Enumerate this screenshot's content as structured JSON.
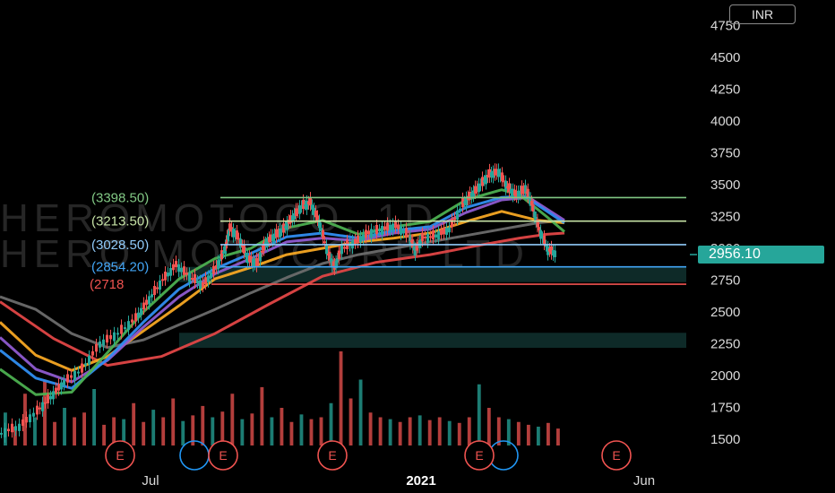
{
  "header": {
    "currency": "INR"
  },
  "watermark": {
    "symbol": "HEROMOTOCO, 1D",
    "name": "HERO MOTOCORP LTD"
  },
  "price_tag": {
    "value": "2956.10",
    "color": "#26a69a"
  },
  "colors": {
    "up": "#26a69a",
    "down": "#ef5350",
    "ma_green": "#4caf50",
    "ma_teal": "#26c6a0",
    "ma_blue": "#2f8df0",
    "ma_purple": "#8e5bd0",
    "ma_orange": "#f5a623",
    "ma_red": "#e04646",
    "ma_gray": "#6b6b6b",
    "event_marker": "#ef5350",
    "split_marker": "#2196f3"
  },
  "event_markers": {
    "earnings_label": "E"
  },
  "chart_data": {
    "type": "line",
    "title": "",
    "ylim": [
      1400,
      4800
    ],
    "y_ticks": [
      "4750",
      "4500",
      "4250",
      "4000",
      "3750",
      "3500",
      "3250",
      "3000",
      "2750",
      "2500",
      "2250",
      "2000",
      "1750",
      "1500"
    ],
    "x_tick_labels": [
      "Jul",
      "2021",
      "Jun"
    ],
    "levels": [
      {
        "label": "(3398.50)",
        "value": 3398.5,
        "color": "#81c784"
      },
      {
        "label": "(3213.50)",
        "value": 3213.5,
        "color": "#c5e1a5"
      },
      {
        "label": "(3028.50)",
        "value": 3028.5,
        "color": "#90caf9"
      },
      {
        "label": "(2854.20)",
        "value": 2854.2,
        "color": "#42a5f5"
      },
      {
        "label": "(2718",
        "value": 2718,
        "color": "#ef5350"
      }
    ],
    "zones": [
      {
        "from": 2734,
        "to": 2854,
        "color": "#0e2a28"
      },
      {
        "from": 2218,
        "to": 2336,
        "color": "#0e2a28"
      }
    ],
    "price_series": {
      "name": "",
      "x": [
        0,
        20,
        40,
        55,
        70,
        90,
        110,
        130,
        150,
        165,
        180,
        195,
        210,
        225,
        240,
        250,
        255,
        265,
        275,
        285,
        295,
        305,
        315,
        325,
        335,
        345,
        355,
        365,
        372,
        380,
        395,
        410,
        425,
        440,
        455,
        462,
        470,
        485,
        500,
        515,
        525,
        535,
        545,
        555,
        565,
        575,
        585,
        592,
        600,
        610,
        620
      ],
      "values": [
        1550,
        1600,
        1720,
        1830,
        1950,
        2050,
        2250,
        2330,
        2450,
        2600,
        2750,
        2870,
        2780,
        2710,
        2850,
        3000,
        3160,
        3080,
        2920,
        2880,
        3040,
        3100,
        3150,
        3240,
        3330,
        3360,
        3200,
        2950,
        2850,
        3000,
        3050,
        3120,
        3150,
        3180,
        3100,
        2980,
        3080,
        3100,
        3150,
        3350,
        3420,
        3500,
        3580,
        3600,
        3480,
        3420,
        3470,
        3350,
        3150,
        2990,
        2956
      ]
    },
    "moving_averages": [
      {
        "name": "",
        "color": "#6b6b6b",
        "x": [
          0,
          40,
          80,
          120,
          160,
          200,
          240,
          280,
          320,
          360,
          400,
          440,
          480,
          520,
          560,
          600,
          630
        ],
        "values": [
          2620,
          2520,
          2330,
          2220,
          2280,
          2400,
          2520,
          2650,
          2770,
          2880,
          2950,
          3000,
          3050,
          3100,
          3150,
          3200,
          3220
        ]
      },
      {
        "name": "",
        "color": "#e04646",
        "x": [
          0,
          60,
          120,
          180,
          240,
          300,
          360,
          420,
          480,
          540,
          580,
          610,
          630
        ],
        "values": [
          2580,
          2290,
          2080,
          2150,
          2330,
          2560,
          2780,
          2890,
          2950,
          3030,
          3080,
          3110,
          3120
        ]
      },
      {
        "name": "",
        "color": "#f5a623",
        "x": [
          0,
          40,
          80,
          120,
          160,
          200,
          240,
          280,
          320,
          360,
          400,
          440,
          480,
          520,
          560,
          600,
          630
        ],
        "values": [
          2420,
          2160,
          2040,
          2150,
          2350,
          2550,
          2760,
          2850,
          2950,
          3000,
          3050,
          3080,
          3120,
          3210,
          3290,
          3220,
          3200
        ]
      },
      {
        "name": "",
        "color": "#8e5bd0",
        "x": [
          0,
          40,
          80,
          120,
          160,
          200,
          240,
          280,
          320,
          360,
          400,
          440,
          480,
          520,
          560,
          590,
          630
        ],
        "values": [
          2300,
          2050,
          1950,
          2120,
          2380,
          2620,
          2800,
          2920,
          3050,
          3080,
          3060,
          3120,
          3150,
          3280,
          3380,
          3400,
          3220
        ]
      },
      {
        "name": "",
        "color": "#2f8df0",
        "x": [
          0,
          40,
          80,
          120,
          160,
          200,
          240,
          280,
          320,
          360,
          400,
          440,
          480,
          520,
          560,
          585,
          630
        ],
        "values": [
          2200,
          1980,
          1900,
          2130,
          2420,
          2680,
          2840,
          2960,
          3090,
          3120,
          3080,
          3140,
          3170,
          3320,
          3400,
          3410,
          3200
        ]
      },
      {
        "name": "",
        "color": "#4caf50",
        "x": [
          0,
          40,
          80,
          120,
          160,
          200,
          240,
          280,
          320,
          360,
          400,
          440,
          480,
          520,
          560,
          580,
          610,
          630
        ],
        "values": [
          2050,
          1850,
          1870,
          2180,
          2500,
          2760,
          2920,
          3000,
          3160,
          3220,
          3110,
          3170,
          3210,
          3380,
          3460,
          3420,
          3250,
          3130
        ]
      }
    ],
    "volume": {
      "name": "",
      "note": "",
      "ylim": [
        0,
        1
      ],
      "values": [
        0.35,
        0.2,
        0.55,
        0.3,
        0.7,
        0.25,
        0.4,
        0.3,
        0.35,
        0.6,
        0.22,
        0.3,
        0.28,
        0.45,
        0.25,
        0.38,
        0.3,
        0.5,
        0.26,
        0.32,
        0.42,
        0.3,
        0.36,
        0.55,
        0.28,
        0.34,
        0.62,
        0.3,
        0.4,
        0.25,
        0.33,
        0.28,
        0.3,
        0.45,
        1.0,
        0.5,
        0.7,
        0.35,
        0.3,
        0.28,
        0.25,
        0.3,
        0.32,
        0.27,
        0.3,
        0.26,
        0.24,
        0.3,
        0.65,
        0.4,
        0.3,
        0.28,
        0.25,
        0.22,
        0.2,
        0.24,
        0.18
      ]
    },
    "earnings_markers_x": [
      134,
      249,
      371,
      535,
      688
    ],
    "split_markers_x": [
      217,
      562
    ]
  }
}
